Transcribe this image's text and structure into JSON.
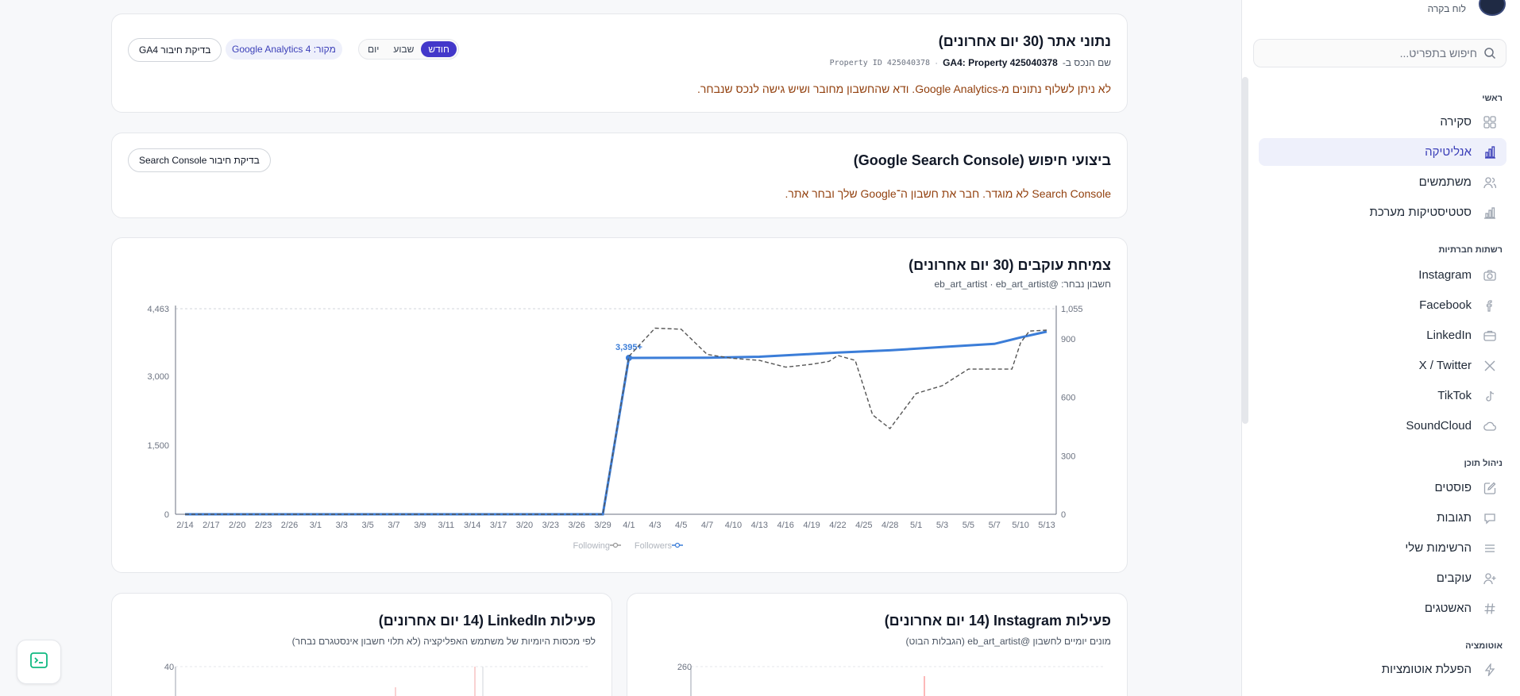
{
  "sidebar": {
    "dashboard_link": "לוח בקרה",
    "search_placeholder": "חיפוש בתפריט...",
    "sections": [
      {
        "title": "ראשי",
        "items": [
          {
            "label": "סקירה",
            "icon": "grid-icon"
          },
          {
            "label": "אנליטיקה",
            "icon": "bar-chart-icon",
            "active": true
          },
          {
            "label": "משתמשים",
            "icon": "users-icon"
          },
          {
            "label": "סטטיסטיקות מערכת",
            "icon": "stats-icon"
          }
        ]
      },
      {
        "title": "רשתות חברתיות",
        "items": [
          {
            "label": "Instagram",
            "icon": "camera-icon"
          },
          {
            "label": "Facebook",
            "icon": "facebook-icon"
          },
          {
            "label": "LinkedIn",
            "icon": "briefcase-icon"
          },
          {
            "label": "X / Twitter",
            "icon": "x-icon"
          },
          {
            "label": "TikTok",
            "icon": "music-note-icon"
          },
          {
            "label": "SoundCloud",
            "icon": "cloud-icon"
          }
        ]
      },
      {
        "title": "ניהול תוכן",
        "items": [
          {
            "label": "פוסטים",
            "icon": "edit-icon"
          },
          {
            "label": "תגובות",
            "icon": "comment-icon"
          },
          {
            "label": "הרשימות שלי",
            "icon": "list-icon"
          },
          {
            "label": "עוקבים",
            "icon": "user-plus-icon"
          },
          {
            "label": "האשטגים",
            "icon": "hashtag-icon"
          }
        ]
      },
      {
        "title": "אוטומציה",
        "items": [
          {
            "label": "הפעלת אוטומציות",
            "icon": "bolt-icon"
          }
        ]
      }
    ]
  },
  "site_card": {
    "title": "נתוני אתר (30 יום אחרונים)",
    "property_label": "שם הנכס ב-",
    "property_value": "GA4: Property 425040378",
    "property_id": "Property ID 425040378",
    "separator": "·",
    "periods": [
      "יום",
      "שבוע",
      "חודש"
    ],
    "active_period": "חודש",
    "source": "מקור: Google Analytics 4",
    "check_button": "בדיקת חיבור GA4",
    "warning": "לא ניתן לשלוף נתונים מ-Google Analytics. ודא שהחשבון מחובר ושיש גישה לנכס שנבחר."
  },
  "search_card": {
    "title": "ביצועי חיפוש (Google Search Console)",
    "check_button": "בדיקת חיבור Search Console",
    "warning": "Search Console לא מוגדר. חבר את חשבון ה־Google שלך ובחר אתר."
  },
  "followers_card": {
    "title": "צמיחת עוקבים (30 יום אחרונים)",
    "subtitle": "חשבון נבחר: @eb_art_artist · eb_art_artist"
  },
  "instagram_card": {
    "title": "פעילות Instagram (14 יום אחרונים)",
    "subtitle": "מונים יומיים לחשבון @eb_art_artist (הגבלות הבוט)",
    "ytick_top": "260"
  },
  "linkedin_card": {
    "title": "פעילות LinkedIn (14 יום אחרונים)",
    "subtitle": "לפי מכסות היומיות של משתמש האפליקציה (לא תלוי חשבון אינסטגרם נבחר)",
    "ytick_top": "40"
  },
  "colors": {
    "accent": "#4338ca",
    "followers_line": "#3b7dd8",
    "following_line": "#555555",
    "warning": "#92400e"
  },
  "chart_data": {
    "type": "line",
    "x": [
      "2/14",
      "2/17",
      "2/20",
      "2/23",
      "2/26",
      "3/1",
      "3/3",
      "3/5",
      "3/7",
      "3/9",
      "3/11",
      "3/14",
      "3/17",
      "3/20",
      "3/23",
      "3/26",
      "3/29",
      "4/1",
      "4/3",
      "4/5",
      "4/7",
      "4/10",
      "4/13",
      "4/16",
      "4/19",
      "4/22",
      "4/25",
      "4/28",
      "5/1",
      "5/3",
      "5/5",
      "5/7",
      "5/10",
      "5/13"
    ],
    "y_left": {
      "ticks": [
        "0",
        "1,500",
        "3,000",
        "4,463"
      ],
      "lim": [
        0,
        4463
      ]
    },
    "y_right": {
      "ticks": [
        "0",
        "300",
        "600",
        "900",
        "1,055"
      ],
      "lim": [
        0,
        1055
      ]
    },
    "series": [
      {
        "name": "Followers",
        "axis": "left",
        "style": "solid",
        "points": [
          [
            "2/14",
            0
          ],
          [
            "3/29",
            0
          ],
          [
            "4/1",
            3395
          ],
          [
            "4/7",
            3400
          ],
          [
            "4/13",
            3420
          ],
          [
            "4/19",
            3480
          ],
          [
            "4/22",
            3510
          ],
          [
            "4/28",
            3560
          ],
          [
            "5/3",
            3630
          ],
          [
            "5/7",
            3700
          ],
          [
            "5/10",
            3840
          ],
          [
            "5/13",
            3965
          ]
        ],
        "annotation": {
          "x": "4/1",
          "y": 3395,
          "label": "3,395+"
        }
      },
      {
        "name": "Following",
        "axis": "right",
        "style": "dashed",
        "points": [
          [
            "2/14",
            0
          ],
          [
            "3/29",
            0
          ],
          [
            "4/1",
            810
          ],
          [
            "4/3",
            955
          ],
          [
            "4/5",
            950
          ],
          [
            "4/7",
            820
          ],
          [
            "4/10",
            800
          ],
          [
            "4/13",
            790
          ],
          [
            "4/16",
            755
          ],
          [
            "4/19",
            770
          ],
          [
            "4/21",
            785
          ],
          [
            "4/22",
            815
          ],
          [
            "4/24",
            790
          ],
          [
            "4/26",
            510
          ],
          [
            "4/28",
            440
          ],
          [
            "5/1",
            620
          ],
          [
            "5/3",
            660
          ],
          [
            "5/5",
            745
          ],
          [
            "5/9",
            745
          ],
          [
            "5/10",
            880
          ],
          [
            "5/11",
            940
          ],
          [
            "5/13",
            945
          ]
        ]
      }
    ],
    "legend_position": "bottom"
  }
}
